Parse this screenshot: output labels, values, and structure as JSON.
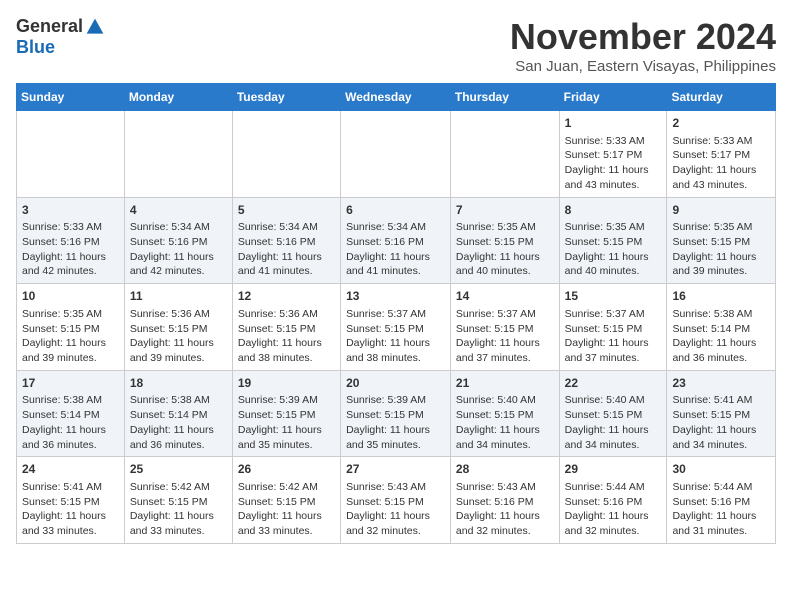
{
  "logo": {
    "general": "General",
    "blue": "Blue"
  },
  "title": "November 2024",
  "subtitle": "San Juan, Eastern Visayas, Philippines",
  "days_of_week": [
    "Sunday",
    "Monday",
    "Tuesday",
    "Wednesday",
    "Thursday",
    "Friday",
    "Saturday"
  ],
  "weeks": [
    [
      {
        "day": "",
        "content": ""
      },
      {
        "day": "",
        "content": ""
      },
      {
        "day": "",
        "content": ""
      },
      {
        "day": "",
        "content": ""
      },
      {
        "day": "",
        "content": ""
      },
      {
        "day": "1",
        "content": "Sunrise: 5:33 AM\nSunset: 5:17 PM\nDaylight: 11 hours and 43 minutes."
      },
      {
        "day": "2",
        "content": "Sunrise: 5:33 AM\nSunset: 5:17 PM\nDaylight: 11 hours and 43 minutes."
      }
    ],
    [
      {
        "day": "3",
        "content": "Sunrise: 5:33 AM\nSunset: 5:16 PM\nDaylight: 11 hours and 42 minutes."
      },
      {
        "day": "4",
        "content": "Sunrise: 5:34 AM\nSunset: 5:16 PM\nDaylight: 11 hours and 42 minutes."
      },
      {
        "day": "5",
        "content": "Sunrise: 5:34 AM\nSunset: 5:16 PM\nDaylight: 11 hours and 41 minutes."
      },
      {
        "day": "6",
        "content": "Sunrise: 5:34 AM\nSunset: 5:16 PM\nDaylight: 11 hours and 41 minutes."
      },
      {
        "day": "7",
        "content": "Sunrise: 5:35 AM\nSunset: 5:15 PM\nDaylight: 11 hours and 40 minutes."
      },
      {
        "day": "8",
        "content": "Sunrise: 5:35 AM\nSunset: 5:15 PM\nDaylight: 11 hours and 40 minutes."
      },
      {
        "day": "9",
        "content": "Sunrise: 5:35 AM\nSunset: 5:15 PM\nDaylight: 11 hours and 39 minutes."
      }
    ],
    [
      {
        "day": "10",
        "content": "Sunrise: 5:35 AM\nSunset: 5:15 PM\nDaylight: 11 hours and 39 minutes."
      },
      {
        "day": "11",
        "content": "Sunrise: 5:36 AM\nSunset: 5:15 PM\nDaylight: 11 hours and 39 minutes."
      },
      {
        "day": "12",
        "content": "Sunrise: 5:36 AM\nSunset: 5:15 PM\nDaylight: 11 hours and 38 minutes."
      },
      {
        "day": "13",
        "content": "Sunrise: 5:37 AM\nSunset: 5:15 PM\nDaylight: 11 hours and 38 minutes."
      },
      {
        "day": "14",
        "content": "Sunrise: 5:37 AM\nSunset: 5:15 PM\nDaylight: 11 hours and 37 minutes."
      },
      {
        "day": "15",
        "content": "Sunrise: 5:37 AM\nSunset: 5:15 PM\nDaylight: 11 hours and 37 minutes."
      },
      {
        "day": "16",
        "content": "Sunrise: 5:38 AM\nSunset: 5:14 PM\nDaylight: 11 hours and 36 minutes."
      }
    ],
    [
      {
        "day": "17",
        "content": "Sunrise: 5:38 AM\nSunset: 5:14 PM\nDaylight: 11 hours and 36 minutes."
      },
      {
        "day": "18",
        "content": "Sunrise: 5:38 AM\nSunset: 5:14 PM\nDaylight: 11 hours and 36 minutes."
      },
      {
        "day": "19",
        "content": "Sunrise: 5:39 AM\nSunset: 5:15 PM\nDaylight: 11 hours and 35 minutes."
      },
      {
        "day": "20",
        "content": "Sunrise: 5:39 AM\nSunset: 5:15 PM\nDaylight: 11 hours and 35 minutes."
      },
      {
        "day": "21",
        "content": "Sunrise: 5:40 AM\nSunset: 5:15 PM\nDaylight: 11 hours and 34 minutes."
      },
      {
        "day": "22",
        "content": "Sunrise: 5:40 AM\nSunset: 5:15 PM\nDaylight: 11 hours and 34 minutes."
      },
      {
        "day": "23",
        "content": "Sunrise: 5:41 AM\nSunset: 5:15 PM\nDaylight: 11 hours and 34 minutes."
      }
    ],
    [
      {
        "day": "24",
        "content": "Sunrise: 5:41 AM\nSunset: 5:15 PM\nDaylight: 11 hours and 33 minutes."
      },
      {
        "day": "25",
        "content": "Sunrise: 5:42 AM\nSunset: 5:15 PM\nDaylight: 11 hours and 33 minutes."
      },
      {
        "day": "26",
        "content": "Sunrise: 5:42 AM\nSunset: 5:15 PM\nDaylight: 11 hours and 33 minutes."
      },
      {
        "day": "27",
        "content": "Sunrise: 5:43 AM\nSunset: 5:15 PM\nDaylight: 11 hours and 32 minutes."
      },
      {
        "day": "28",
        "content": "Sunrise: 5:43 AM\nSunset: 5:16 PM\nDaylight: 11 hours and 32 minutes."
      },
      {
        "day": "29",
        "content": "Sunrise: 5:44 AM\nSunset: 5:16 PM\nDaylight: 11 hours and 32 minutes."
      },
      {
        "day": "30",
        "content": "Sunrise: 5:44 AM\nSunset: 5:16 PM\nDaylight: 11 hours and 31 minutes."
      }
    ]
  ]
}
